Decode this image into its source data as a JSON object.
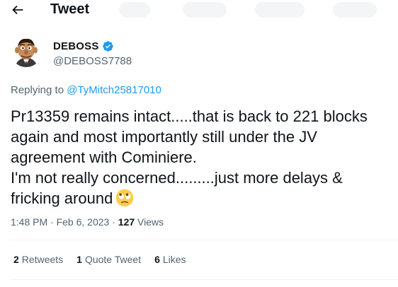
{
  "header": {
    "title": "Tweet"
  },
  "author": {
    "name": "DEBOSS",
    "handle": "@DEBOSS7788",
    "verified": true
  },
  "reply": {
    "prefix": "Replying to ",
    "mention": "@TyMitch25817010"
  },
  "tweet": {
    "lines": [
      "Pr13359 remains intact.....that is back to 221 blocks",
      "again and most importantly still under the JV",
      "agreement with Cominiere.",
      "I'm not really concerned.........just more delays &",
      "fricking around"
    ],
    "emoji": "face-with-rolling-eyes-emoji"
  },
  "meta": {
    "time": "1:48 PM",
    "sep": " · ",
    "date": "Feb 6, 2023",
    "sep2": " · ",
    "views_count": "127",
    "views_label": " Views"
  },
  "stats": [
    {
      "num": "2",
      "label": "Retweets"
    },
    {
      "num": "1",
      "label": "Quote Tweet"
    },
    {
      "num": "6",
      "label": "Likes"
    }
  ],
  "colors": {
    "accent": "#1d9bf0",
    "text": "#0f1419",
    "muted": "#536471",
    "divider": "#eff3f4"
  }
}
